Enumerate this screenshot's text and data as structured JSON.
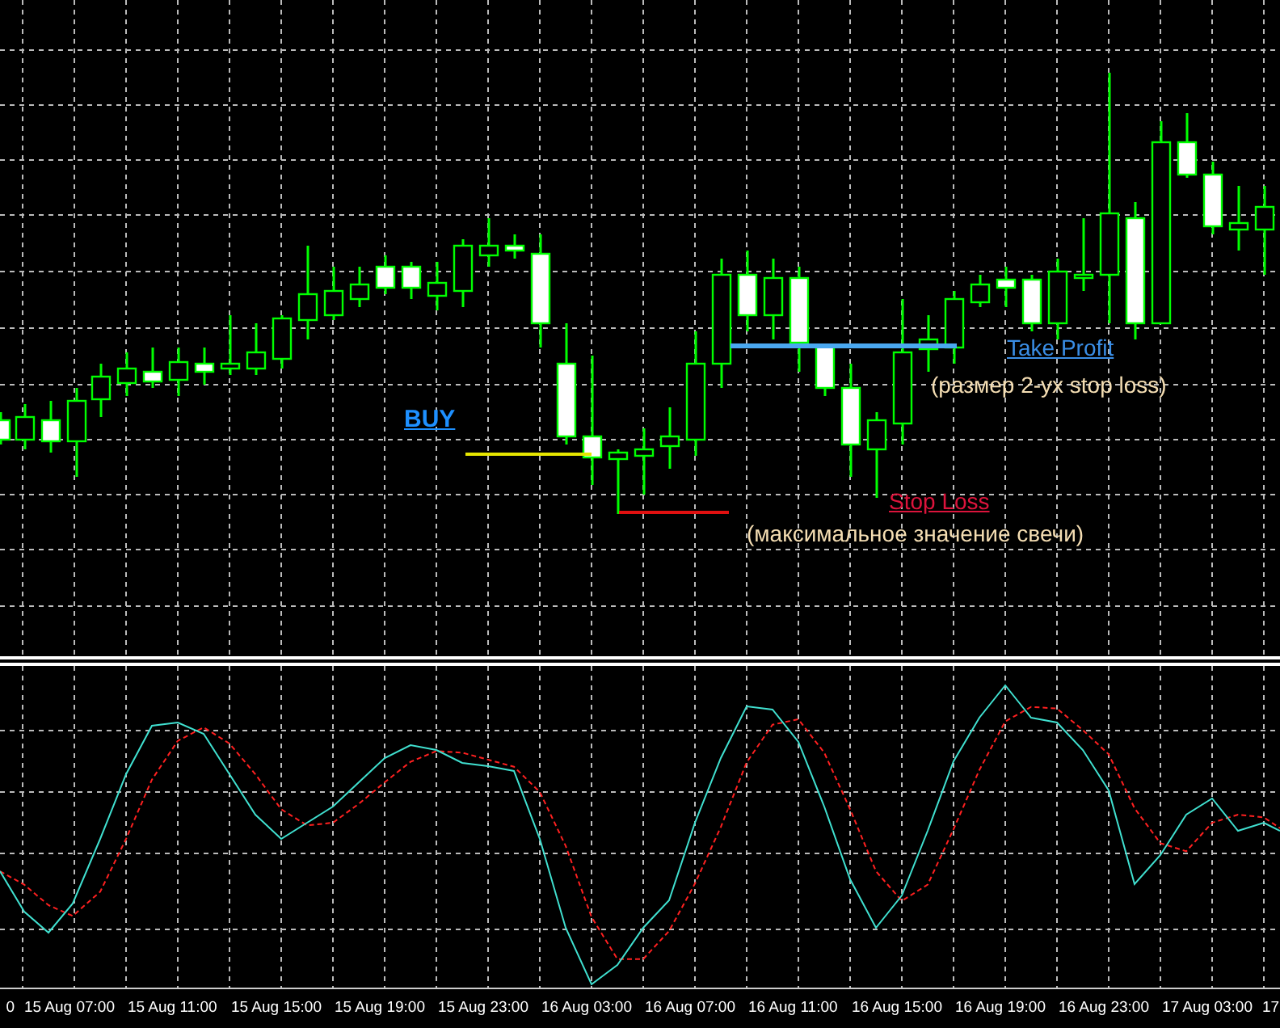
{
  "chart": {
    "annotations": [
      {
        "kind": "buy",
        "text": "BUY"
      },
      {
        "kind": "take_profit",
        "text": "Take Profit"
      },
      {
        "kind": "take_profit_note",
        "text": "(размер 2-ух stop loss)"
      },
      {
        "kind": "stop_loss",
        "text": "Stop Loss"
      },
      {
        "kind": "stop_loss_note",
        "text": "(максимальное значение свечи)"
      }
    ]
  },
  "time_axis": {
    "labels": [
      "0",
      "15 Aug 07:00",
      "15 Aug 11:00",
      "15 Aug 15:00",
      "15 Aug 19:00",
      "15 Aug 23:00",
      "16 Aug 03:00",
      "16 Aug 07:00",
      "16 Aug 11:00",
      "16 Aug 15:00",
      "16 Aug 19:00",
      "16 Aug 23:00",
      "17 Aug 03:00",
      "17"
    ]
  }
}
